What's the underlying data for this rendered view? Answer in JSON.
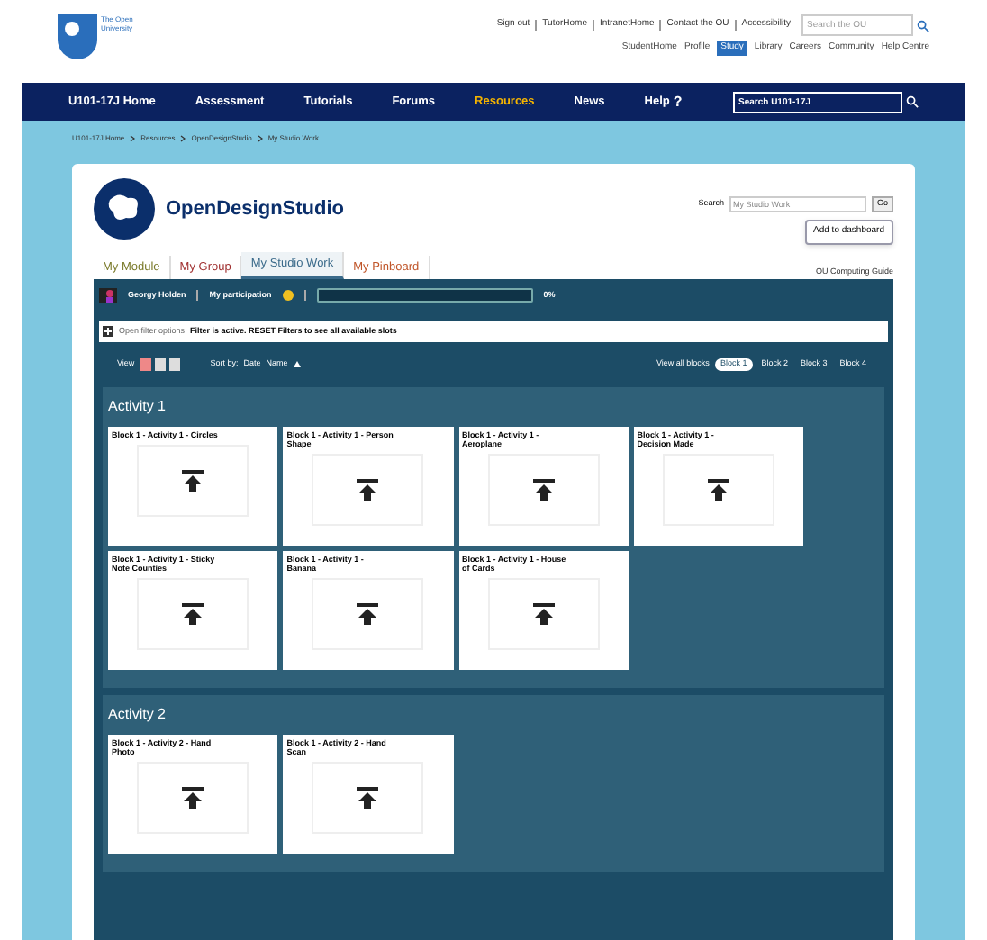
{
  "header": {
    "university": "The Open University",
    "top_links": [
      "Sign out",
      "TutorHome",
      "IntranetHome",
      "Contact the OU",
      "Accessibility"
    ],
    "search": {
      "placeholder": "Search the OU"
    },
    "sub_links": [
      {
        "label": "StudentHome",
        "selected": false
      },
      {
        "label": "Profile",
        "selected": false
      },
      {
        "label": "Study",
        "selected": true
      },
      {
        "label": "Library",
        "selected": false
      },
      {
        "label": "Careers",
        "selected": false
      },
      {
        "label": "Community",
        "selected": false
      },
      {
        "label": "Help Centre",
        "selected": false
      }
    ]
  },
  "nav": {
    "items": [
      {
        "label": "U101-17J Home",
        "selected": false
      },
      {
        "label": "Assessment",
        "selected": false
      },
      {
        "label": "Tutorials",
        "selected": false
      },
      {
        "label": "Forums",
        "selected": false
      },
      {
        "label": "Resources",
        "selected": true
      },
      {
        "label": "News",
        "selected": false
      }
    ],
    "help": "Help",
    "help_icon": "?",
    "search": {
      "placeholder": "Search U101-17J"
    }
  },
  "breadcrumb": [
    "U101-17J Home",
    "Resources",
    "OpenDesignStudio",
    "My Studio Work"
  ],
  "studio": {
    "title": "OpenDesignStudio",
    "search_label": "Search",
    "search": {
      "placeholder": "My Studio Work"
    },
    "go": "Go",
    "add_button": "Add to dashboard",
    "tabs": [
      {
        "label": "My Module",
        "selected": false,
        "color": "#7a7a2a"
      },
      {
        "label": "My Group",
        "selected": false,
        "color": "#a03030"
      },
      {
        "label": "My Studio Work",
        "selected": true,
        "color": "#3a6a8a"
      },
      {
        "label": "My Pinboard",
        "selected": false,
        "color": "#c0562a"
      }
    ],
    "guide": "OU Computing Guide",
    "user": "Georgy Holden",
    "participation": {
      "label": "My participation",
      "level": 0,
      "reading": "0%"
    },
    "filter": {
      "toggle": "Open filter options",
      "message": "Filter is active. RESET Filters to see all available slots"
    },
    "view_label": "View",
    "sort_label": "Sort by:",
    "sort_options": [
      "Date",
      "Name"
    ],
    "blocks_label": "View all blocks",
    "blocks": [
      {
        "label": "Block 1",
        "selected": true
      },
      {
        "label": "Block 2",
        "selected": false
      },
      {
        "label": "Block 3",
        "selected": false
      },
      {
        "label": "Block 4",
        "selected": false
      }
    ],
    "activities": [
      {
        "title": "Activity 1",
        "slots": [
          "Block 1 - Activity 1 - Circles",
          "Block 1 - Activity 1 - Person Shape",
          "Block 1 - Activity 1 - Aeroplane",
          "Block 1 - Activity 1 - Decision Made",
          "Block 1 - Activity 1 - Sticky Note Counties",
          "Block 1 - Activity 1 - Banana",
          "Block 1 - Activity 1 - House of Cards"
        ]
      },
      {
        "title": "Activity 2",
        "slots": [
          "Block 1 - Activity 2 - Hand Photo",
          "Block 1 - Activity 2 - Hand Scan"
        ]
      }
    ]
  }
}
